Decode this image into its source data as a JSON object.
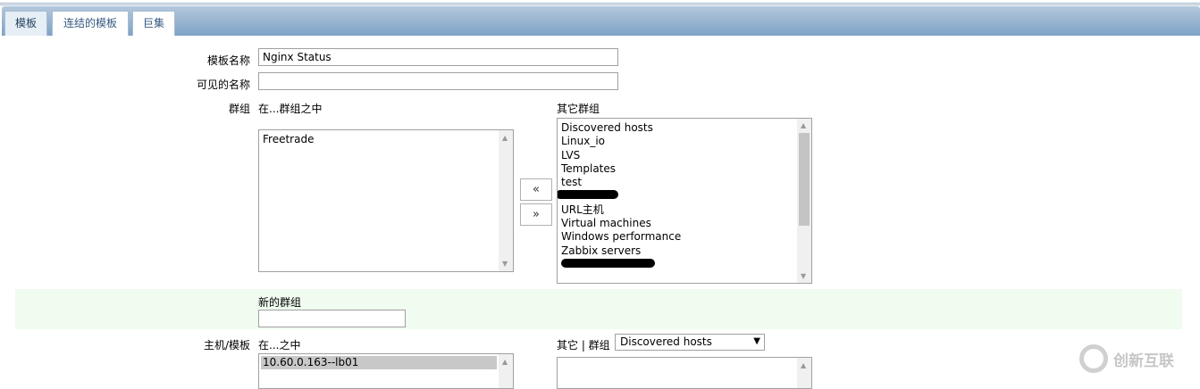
{
  "tabs": [
    {
      "label": "模板"
    },
    {
      "label": "连结的模板"
    },
    {
      "label": "巨集"
    }
  ],
  "form": {
    "template_name_label": "模板名称",
    "template_name_value": "Nginx Status",
    "visible_name_label": "可见的名称",
    "visible_name_value": "",
    "groups_label": "群组",
    "in_groups_label": "在...群组之中",
    "other_groups_label": "其它群组",
    "in_groups": [
      "Freetrade"
    ],
    "other_groups": [
      "Discovered hosts",
      "Linux_io",
      "LVS",
      "Templates",
      "test",
      "[redacted]",
      "URL主机",
      "Virtual machines",
      "Windows performance",
      "Zabbix servers",
      "[redacted]"
    ],
    "move_left": "«",
    "move_right": "»",
    "new_group_label": "新的群组",
    "new_group_value": "",
    "hosts_label": "主机/模板",
    "in_hosts_label": "在...之中",
    "other_hosts_label": "其它 | 群组",
    "group_select_value": "Discovered hosts",
    "in_hosts": [
      "10.60.0.163--lb01"
    ]
  },
  "watermark": "创新互联"
}
